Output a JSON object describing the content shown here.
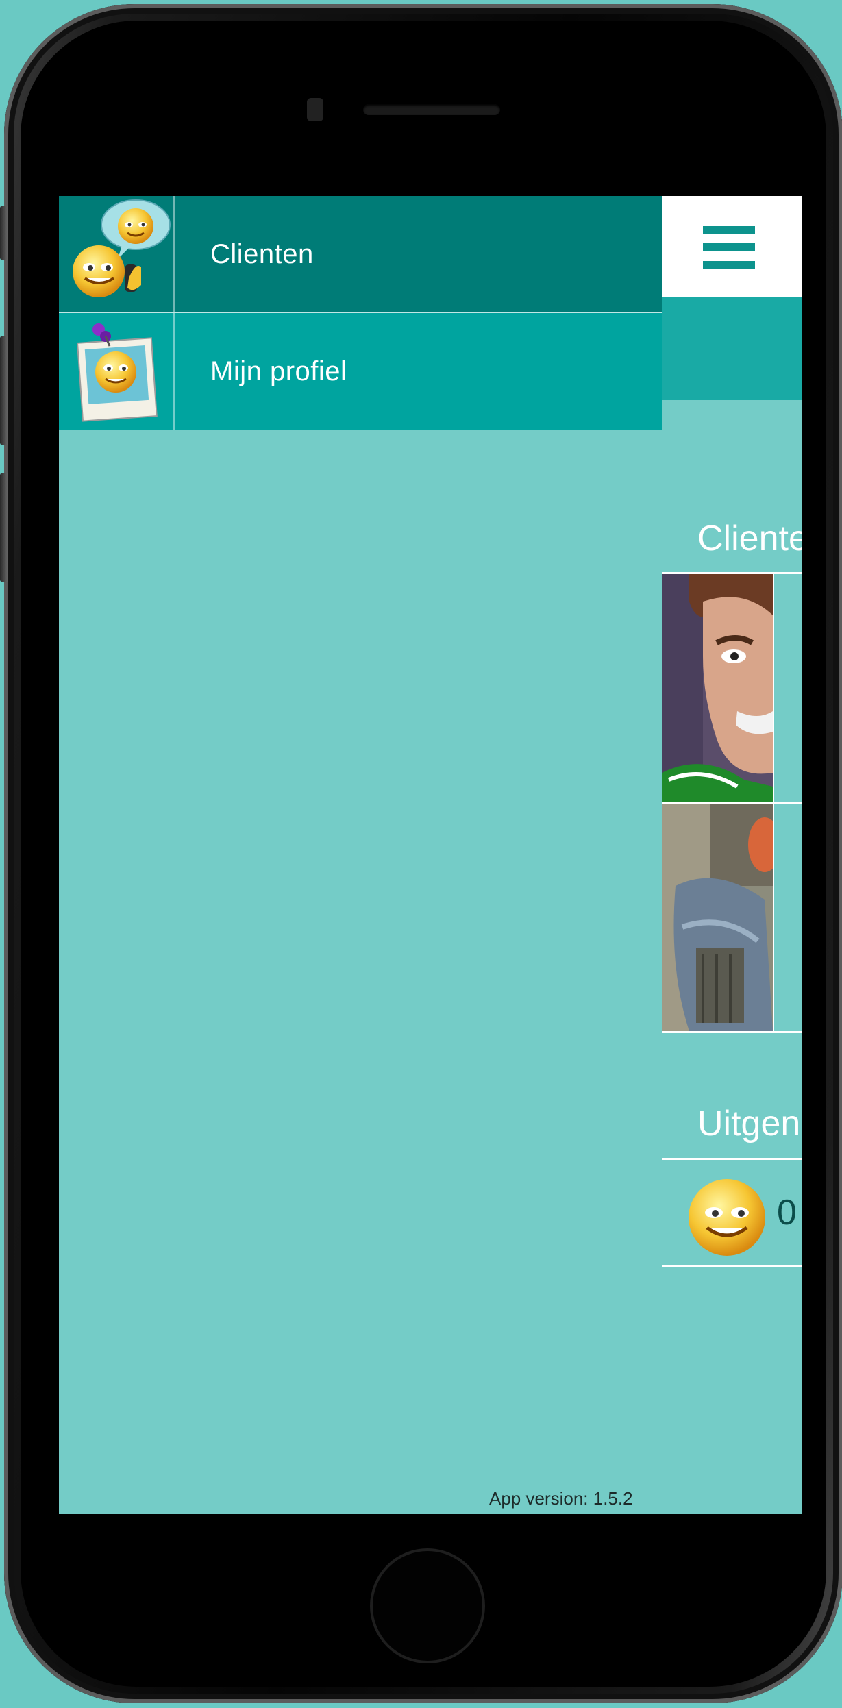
{
  "menu": {
    "items": [
      {
        "label": "Clienten",
        "icon": "clients-smileys-icon"
      },
      {
        "label": "Mijn profiel",
        "icon": "profile-photo-smiley-icon"
      }
    ]
  },
  "footer": {
    "app_version": "App version: 1.5.2"
  },
  "content": {
    "menu_button_icon": "hamburger-icon",
    "clients_section_title": "Clienten",
    "clients": [
      {
        "avatar": "client-avatar-1"
      },
      {
        "avatar": "client-avatar-2"
      }
    ],
    "outgoing_section_title": "Uitgen",
    "outgoing_value": "0"
  },
  "colors": {
    "background": "#74ccc7",
    "menu_active": "#007c77",
    "menu_item": "#00a49f",
    "subbar": "#19aaa5",
    "hamburger": "#0d938d"
  }
}
